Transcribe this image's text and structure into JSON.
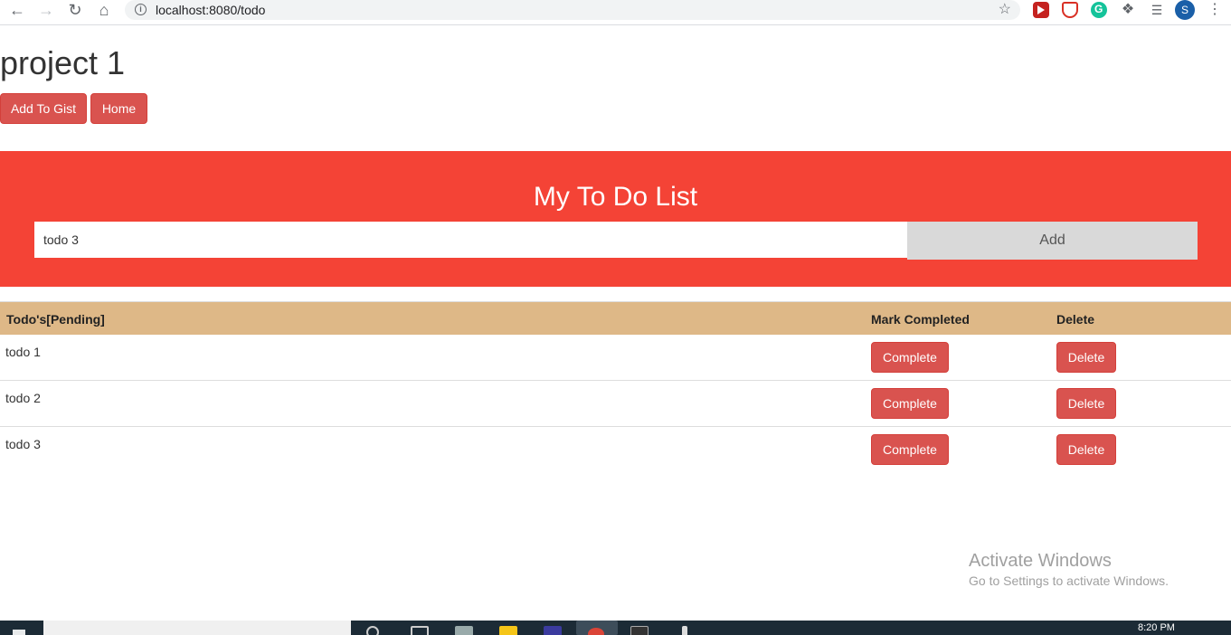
{
  "browser": {
    "url": "localhost:8080/todo",
    "profile_initial": "S"
  },
  "header": {
    "title": "project 1",
    "add_to_gist_label": "Add To Gist",
    "home_label": "Home"
  },
  "banner": {
    "title": "My To Do List",
    "input_value": "todo 3",
    "add_label": "Add"
  },
  "table": {
    "headers": {
      "todo": "Todo's[Pending]",
      "mark": "Mark Completed",
      "delete": "Delete"
    },
    "rows": [
      {
        "text": "todo 1",
        "complete_label": "Complete",
        "delete_label": "Delete"
      },
      {
        "text": "todo 2",
        "complete_label": "Complete",
        "delete_label": "Delete"
      },
      {
        "text": "todo 3",
        "complete_label": "Complete",
        "delete_label": "Delete"
      }
    ]
  },
  "watermark": {
    "title": "Activate Windows",
    "subtitle": "Go to Settings to activate Windows."
  },
  "taskbar": {
    "clock": "8:20 PM"
  },
  "colors": {
    "banner": "#f44336",
    "button": "#d9534f",
    "table_header": "#deb887",
    "add_button": "#d9d9d9"
  }
}
